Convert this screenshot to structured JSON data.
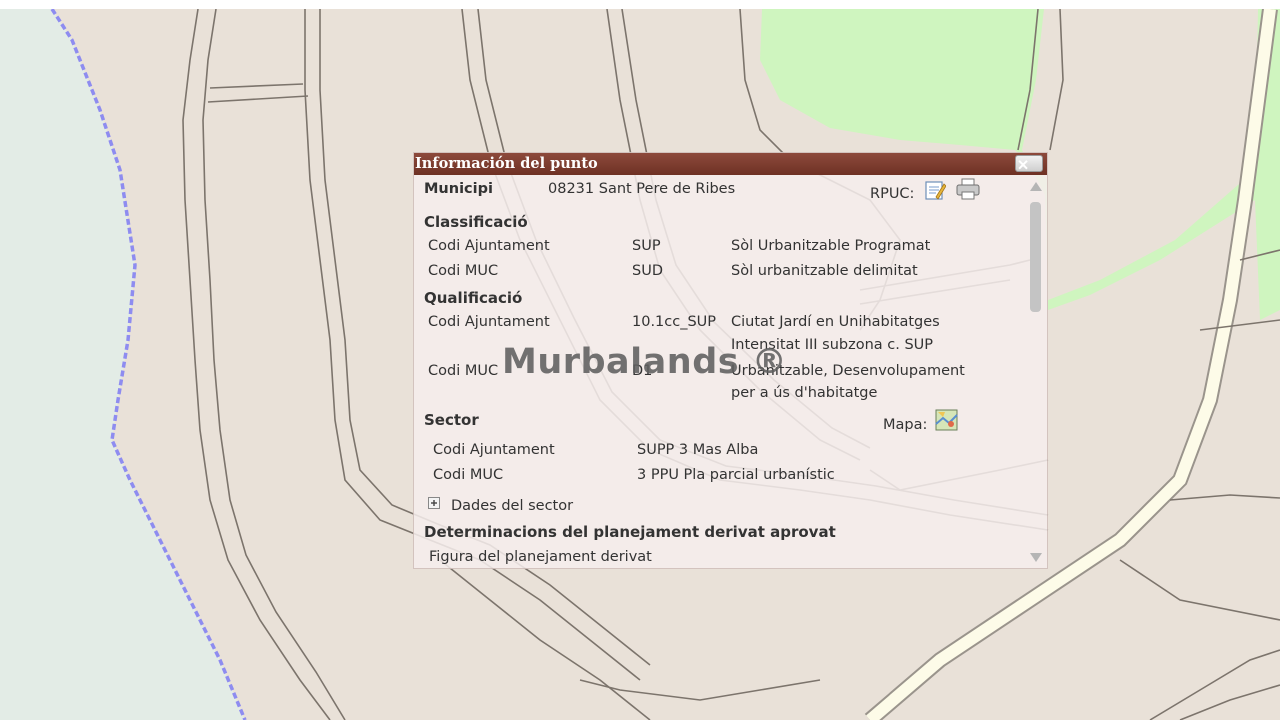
{
  "popup": {
    "title": "Información del punto",
    "close_label": "✕",
    "municipi": {
      "label": "Municipi",
      "value": "08231 Sant Pere de Ribes"
    },
    "rpuc_label": "RPUC:",
    "classificacio": {
      "heading": "Classificació",
      "rows": [
        {
          "label": "Codi Ajuntament",
          "code": "SUP",
          "desc": "Sòl Urbanitzable Programat"
        },
        {
          "label": "Codi MUC",
          "code": "SUD",
          "desc": "Sòl urbanitzable delimitat"
        }
      ]
    },
    "qualificacio": {
      "heading": "Qualificació",
      "rows": [
        {
          "label": "Codi Ajuntament",
          "code": "10.1cc_SUP",
          "desc1": "Ciutat Jardí en Unihabitatges",
          "desc2": "Intensitat III subzona c. SUP"
        },
        {
          "label": "Codi MUC",
          "code": "D1",
          "desc1": "Urbanitzable, Desenvolupament",
          "desc2": "per a ús d'habitatge"
        }
      ]
    },
    "sector": {
      "heading": "Sector",
      "mapa_label": "Mapa:",
      "rows": [
        {
          "label": "Codi Ajuntament",
          "value": "SUPP 3 Mas Alba"
        },
        {
          "label": "Codi MUC",
          "value": "3 PPU Pla parcial urbanístic"
        }
      ],
      "expand_label": "Dades del sector"
    },
    "determinacions": {
      "heading": "Determinacions del planejament derivat aprovat",
      "first_item": "Figura del planejament derivat"
    }
  },
  "watermark": "Murbalands ®",
  "icons": {
    "edit": "edit-document-icon",
    "print": "printer-icon",
    "map": "map-icon",
    "expand": "plus-box-icon"
  },
  "colors": {
    "map_background": "#e9e1d8",
    "water": "#e3ece6",
    "green_zone": "#cff5bf",
    "road_fill": "#fdfbe8",
    "boundary": "#8e8cf0",
    "title_bar": "#7a3a2d"
  }
}
